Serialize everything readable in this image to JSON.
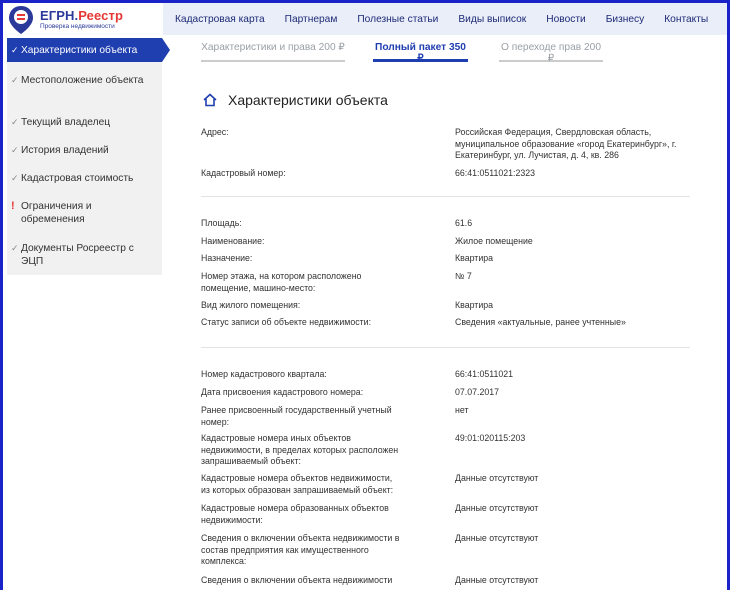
{
  "logo": {
    "title_main": "ЕГРН.",
    "title_accent": "Реестр",
    "subtitle": "Проверка недвижимости"
  },
  "nav": [
    "Кадастровая карта",
    "Партнерам",
    "Полезные статьи",
    "Виды выписок",
    "Новости",
    "Бизнесу",
    "Контакты"
  ],
  "sidebar": [
    {
      "label": "Характеристики объекта",
      "mark": "✓",
      "active": true
    },
    {
      "label": "Местоположение объекта",
      "mark": "✓"
    },
    {
      "label": "Текущий владелец",
      "mark": "✓"
    },
    {
      "label": "История владений",
      "mark": "✓"
    },
    {
      "label": "Кадастровая стоимость",
      "mark": "✓"
    },
    {
      "label": "Ограничения и обременения",
      "mark": "!"
    },
    {
      "label": "Документы Росреестр с ЭЦП",
      "mark": "✓"
    }
  ],
  "tabs": [
    {
      "label": "Характеристики и права 200 ₽"
    },
    {
      "label": "Полный пакет 350 ₽",
      "active": true
    },
    {
      "label": "О переходе прав 200 ₽"
    }
  ],
  "section_title": "Характеристики объекта",
  "groups": [
    [
      {
        "k": "Адрес:",
        "v": "Российская Федерация, Свердловская область, муниципальное образование «город Екатеринбург», г. Екатеринбург, ул. Лучистая, д. 4, кв. 286"
      },
      {
        "k": "Кадастровый номер:",
        "v": "66:41:0511021:2323"
      }
    ],
    [
      {
        "k": "Площадь:",
        "v": "61.6"
      },
      {
        "k": "Наименование:",
        "v": "Жилое помещение"
      },
      {
        "k": "Назначение:",
        "v": "Квартира"
      },
      {
        "k": "Номер этажа, на котором расположено помещение, машино-место:",
        "v": "№ 7"
      },
      {
        "k": "Вид жилого помещения:",
        "v": "Квартира"
      },
      {
        "k": "Статус записи об объекте недвижимости:",
        "v": "Сведения «актуальные, ранее учтенные»"
      }
    ],
    [
      {
        "k": "Номер кадастрового квартала:",
        "v": "66:41:0511021"
      },
      {
        "k": "Дата присвоения кадастрового номера:",
        "v": "07.07.2017"
      },
      {
        "k": "Ранее присвоенный государственный учетный номер:",
        "v": "нет"
      },
      {
        "k": "Кадастровые номера иных объектов недвижимости, в пределах которых расположен запрашиваемый объект:",
        "v": "49:01:020115:203"
      },
      {
        "k": "Кадастровые номера объектов недвижимости, из которых образован запрашиваемый объект:",
        "v": "Данные отсутствуют"
      },
      {
        "k": "Кадастровые номера образованных объектов недвижимости:",
        "v": "Данные отсутствуют"
      },
      {
        "k": "Сведения о включении объекта недвижимости в состав предприятия как имущественного комплекса:",
        "v": "Данные отсутствуют"
      },
      {
        "k": "Сведения о включении объекта недвижимости",
        "v": "Данные отсутствуют"
      }
    ]
  ]
}
